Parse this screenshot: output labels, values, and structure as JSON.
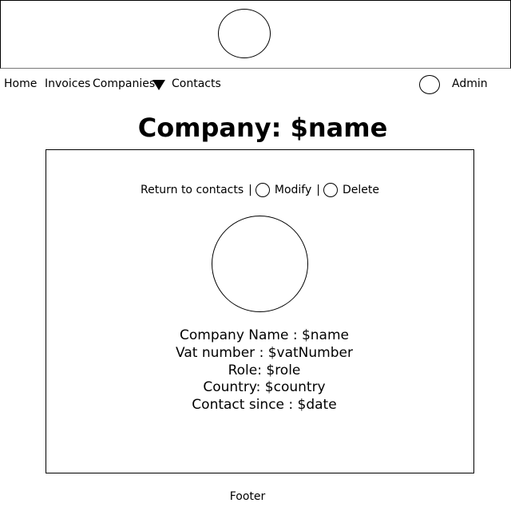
{
  "nav": {
    "home": "Home",
    "invoices": "Invoices",
    "companies": "Companies",
    "contacts": "Contacts",
    "admin": "Admin"
  },
  "page": {
    "title": "Company: $name"
  },
  "actions": {
    "return": "Return to contacts",
    "separator": "|",
    "modify": "Modify",
    "delete": "Delete"
  },
  "details": {
    "name": "Company Name : $name",
    "vat": "Vat number : $vatNumber",
    "role": "Role: $role",
    "country": "Country: $country",
    "since": "Contact since : $date"
  },
  "footer": {
    "text": "Footer"
  },
  "icons": {
    "logo": "logo-placeholder",
    "dropdown": "triangle-down",
    "avatar": "user-avatar",
    "modify": "modify-icon",
    "delete": "delete-icon",
    "company_logo": "company-logo-placeholder"
  }
}
